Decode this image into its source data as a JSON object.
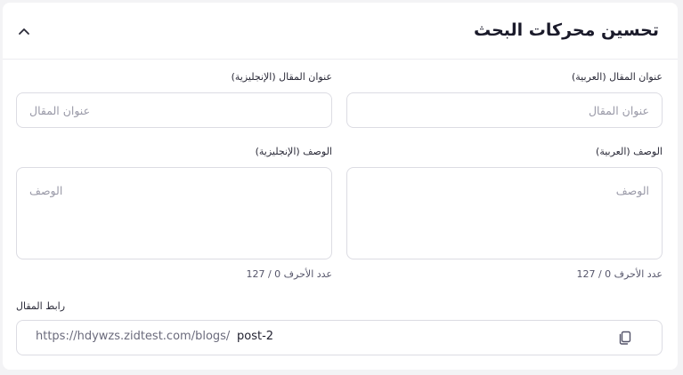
{
  "section": {
    "title": "تحسين محركات البحث",
    "collapse_icon": "chevron-up-icon"
  },
  "fields": {
    "title_ar": {
      "label": "عنوان المقال (العربية)",
      "placeholder": "عنوان المقال",
      "value": ""
    },
    "title_en": {
      "label": "عنوان المقال (الإنجليزية)",
      "placeholder": "عنوان المقال",
      "value": ""
    },
    "desc_ar": {
      "label": "الوصف (العربية)",
      "placeholder": "الوصف",
      "value": "",
      "counter": "عدد الأحرف 0 / 127"
    },
    "desc_en": {
      "label": "الوصف (الإنجليزية)",
      "placeholder": "الوصف",
      "value": "",
      "counter": "عدد الأحرف 0 / 127"
    },
    "url": {
      "label": "رابط المقال",
      "prefix": "https://hdywzs.zidtest.com/blogs/",
      "slug": "post-2",
      "copy_icon": "copy-icon"
    }
  },
  "colors": {
    "background": "#f3f3f5",
    "card": "#ffffff",
    "border": "#dcdce3",
    "placeholder": "#9a9aa8"
  }
}
